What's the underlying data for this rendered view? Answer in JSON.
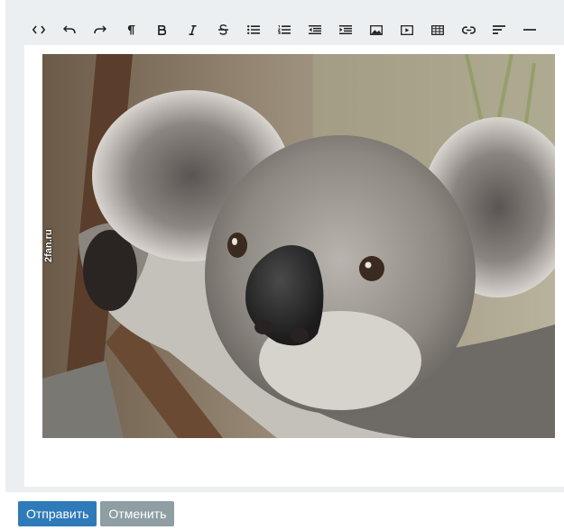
{
  "toolbar": {
    "buttons": [
      {
        "icon": "code-view-icon"
      },
      {
        "icon": "undo-icon"
      },
      {
        "icon": "redo-icon"
      },
      {
        "icon": "paragraph-icon"
      },
      {
        "icon": "bold-icon"
      },
      {
        "icon": "italic-icon"
      },
      {
        "icon": "strikethrough-icon"
      },
      {
        "icon": "unordered-list-icon"
      },
      {
        "icon": "ordered-list-icon"
      },
      {
        "icon": "outdent-icon"
      },
      {
        "icon": "indent-icon"
      },
      {
        "icon": "image-icon"
      },
      {
        "icon": "video-icon"
      },
      {
        "icon": "table-icon"
      },
      {
        "icon": "link-icon"
      },
      {
        "icon": "align-left-icon"
      },
      {
        "icon": "horizontal-rule-icon"
      }
    ]
  },
  "content": {
    "image_watermark": "2fan.ru"
  },
  "actions": {
    "submit_label": "Отправить",
    "cancel_label": "Отменить"
  },
  "colors": {
    "primary": "#2f7ab9",
    "secondary": "#8e9ea3",
    "frame": "#eceff1"
  }
}
